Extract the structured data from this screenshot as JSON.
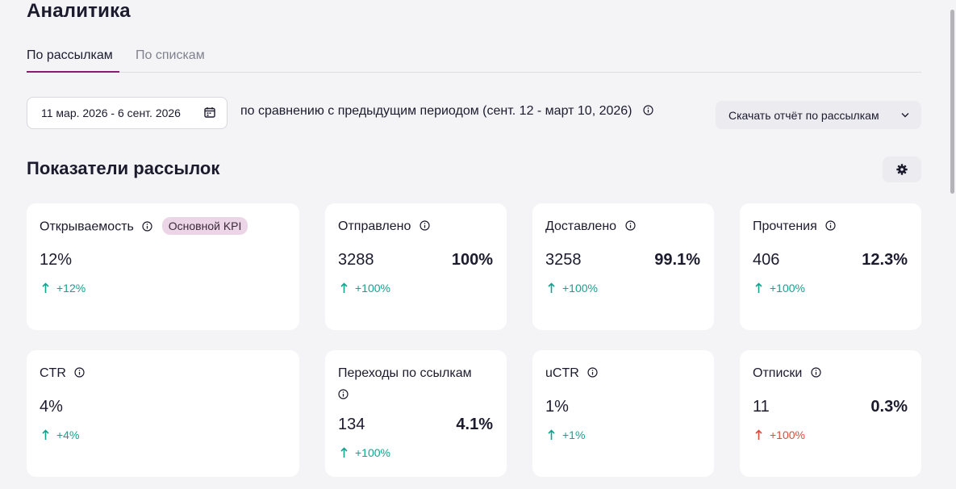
{
  "header": {
    "title": "Аналитика"
  },
  "tabs": [
    {
      "label": "По рассылкам",
      "active": true
    },
    {
      "label": "По спискам",
      "active": false
    }
  ],
  "filters": {
    "date_range": "11 мар. 2026 - 6 сент. 2026",
    "comparison_text": "по сравнению с предыдущим периодом (сент. 12 - март 10, 2026)",
    "download_label": "Скачать отчёт по рассылкам"
  },
  "section": {
    "title": "Показатели рассылок"
  },
  "colors": {
    "accent": "#8a1c6c",
    "positive": "#12a38f",
    "negative": "#e04a3a",
    "badge_bg": "#ecd5e6"
  },
  "cards": [
    {
      "label": "Открываемость",
      "badge": "Основной KPI",
      "value": "12%",
      "percent": "",
      "delta": "+12%",
      "trend": "up"
    },
    {
      "label": "Отправлено",
      "value": "3288",
      "percent": "100%",
      "delta": "+100%",
      "trend": "up"
    },
    {
      "label": "Доставлено",
      "value": "3258",
      "percent": "99.1%",
      "delta": "+100%",
      "trend": "up"
    },
    {
      "label": "Прочтения",
      "value": "406",
      "percent": "12.3%",
      "delta": "+100%",
      "trend": "up"
    },
    {
      "label": "CTR",
      "value": "4%",
      "percent": "",
      "delta": "+4%",
      "trend": "up"
    },
    {
      "label": "Переходы по ссылкам",
      "value": "134",
      "percent": "4.1%",
      "delta": "+100%",
      "trend": "up"
    },
    {
      "label": "uCTR",
      "value": "1%",
      "percent": "",
      "delta": "+1%",
      "trend": "up"
    },
    {
      "label": "Отписки",
      "value": "11",
      "percent": "0.3%",
      "delta": "+100%",
      "trend": "up-negative"
    }
  ],
  "icons": {
    "calendar": "calendar-icon",
    "info": "info-icon",
    "chevron": "chevron-down-icon",
    "settings": "gear-icon",
    "arrow": "arrow-up-icon"
  }
}
